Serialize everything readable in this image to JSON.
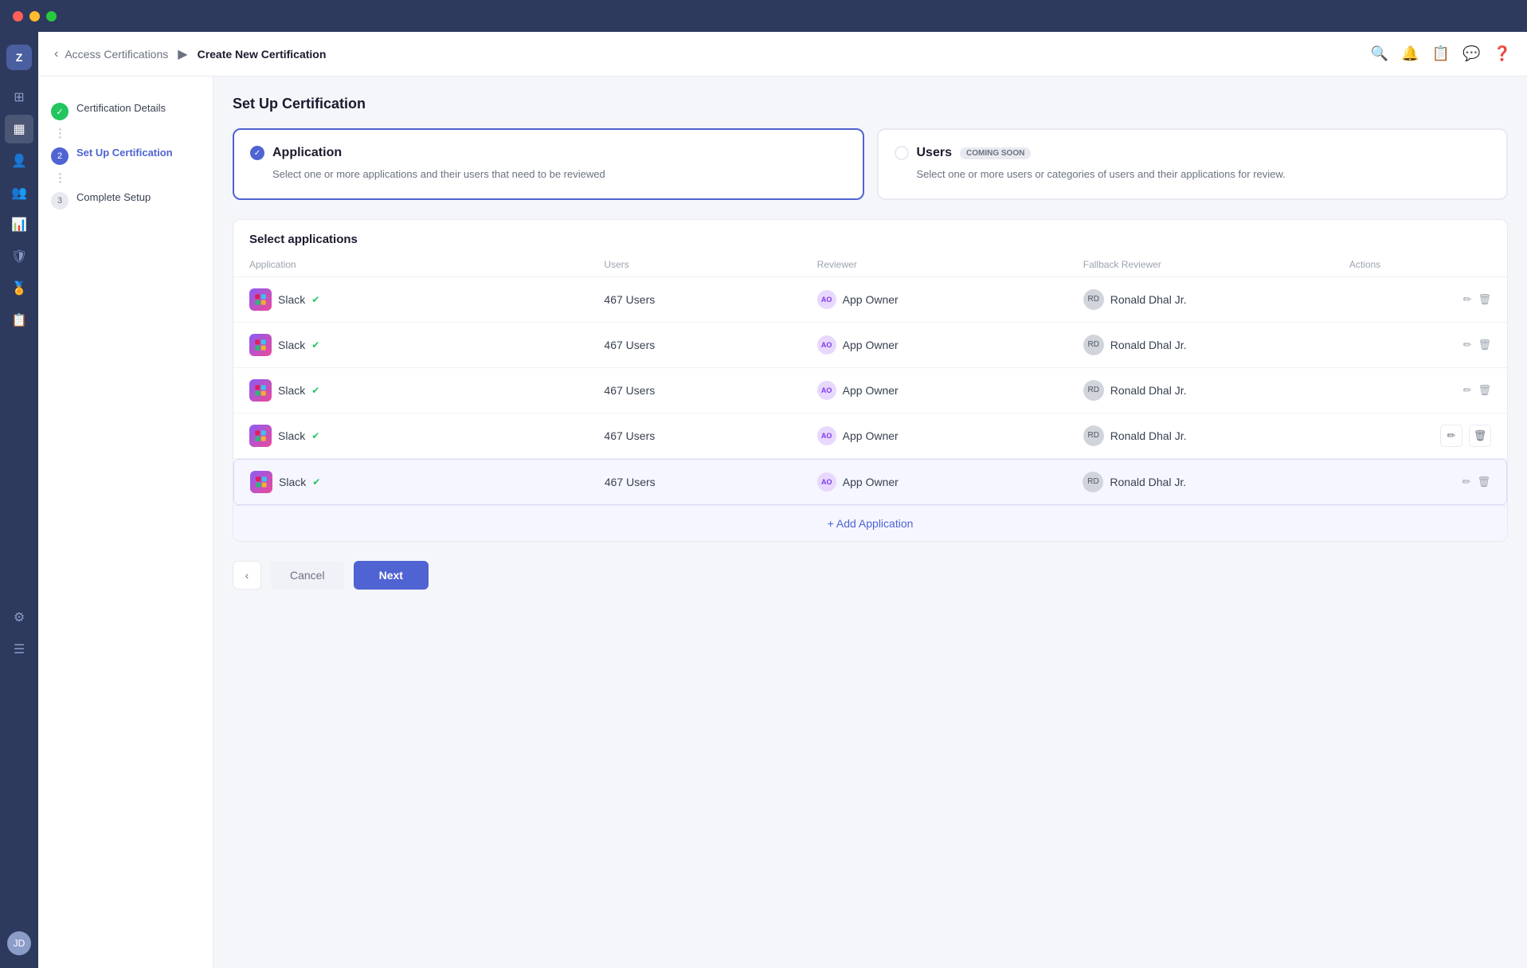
{
  "titlebar": {
    "dots": [
      "red",
      "yellow",
      "green"
    ]
  },
  "topnav": {
    "breadcrumb": "Access Certifications",
    "arrow": "▶",
    "title": "Create New Certification",
    "back_icon": "‹",
    "icons": [
      "search",
      "bell",
      "clipboard",
      "message",
      "help"
    ]
  },
  "sidebar": {
    "logo": "Z",
    "items": [
      {
        "id": "grid",
        "icon": "⊞",
        "active": false
      },
      {
        "id": "calendar",
        "icon": "▦",
        "active": true
      },
      {
        "id": "person",
        "icon": "👤",
        "active": false
      },
      {
        "id": "users",
        "icon": "👥",
        "active": false
      },
      {
        "id": "chart",
        "icon": "📊",
        "active": false
      },
      {
        "id": "shield",
        "icon": "🛡",
        "active": false
      },
      {
        "id": "award",
        "icon": "🏅",
        "active": false
      },
      {
        "id": "doc",
        "icon": "📋",
        "active": false
      }
    ],
    "avatar_initials": "JD"
  },
  "wizard": {
    "steps": [
      {
        "num": "✓",
        "label": "Certification Details",
        "state": "done"
      },
      {
        "num": "2",
        "label": "Set Up Certification",
        "state": "active"
      },
      {
        "num": "3",
        "label": "Complete Setup",
        "state": "pending"
      }
    ]
  },
  "page": {
    "section_title": "Set Up Certification",
    "options": [
      {
        "id": "application",
        "title": "Application",
        "description": "Select one or more applications and their users that need to be reviewed",
        "selected": true,
        "badge": null
      },
      {
        "id": "users",
        "title": "Users",
        "description": "Select one or more users or categories of users and their applications for review.",
        "selected": false,
        "badge": "COMING SOON"
      }
    ],
    "table": {
      "title": "Select applications",
      "headers": [
        "Application",
        "Users",
        "Reviewer",
        "Fallback Reviewer",
        "Actions"
      ],
      "rows": [
        {
          "app": "Slack",
          "users": "467 Users",
          "reviewer": "App Owner",
          "fallback": "Ronald Dhal Jr.",
          "highlighted": false
        },
        {
          "app": "Slack",
          "users": "467 Users",
          "reviewer": "App Owner",
          "fallback": "Ronald Dhal Jr.",
          "highlighted": false
        },
        {
          "app": "Slack",
          "users": "467 Users",
          "reviewer": "App Owner",
          "fallback": "Ronald Dhal Jr.",
          "highlighted": false
        },
        {
          "app": "Slack",
          "users": "467 Users",
          "reviewer": "App Owner",
          "fallback": "Ronald Dhal Jr.",
          "highlighted": false
        },
        {
          "app": "Slack",
          "users": "467 Users",
          "reviewer": "App Owner",
          "fallback": "Ronald Dhal Jr.",
          "highlighted": true
        }
      ],
      "add_label": "+ Add Application"
    },
    "footer": {
      "back_icon": "‹",
      "cancel_label": "Cancel",
      "next_label": "Next"
    }
  }
}
